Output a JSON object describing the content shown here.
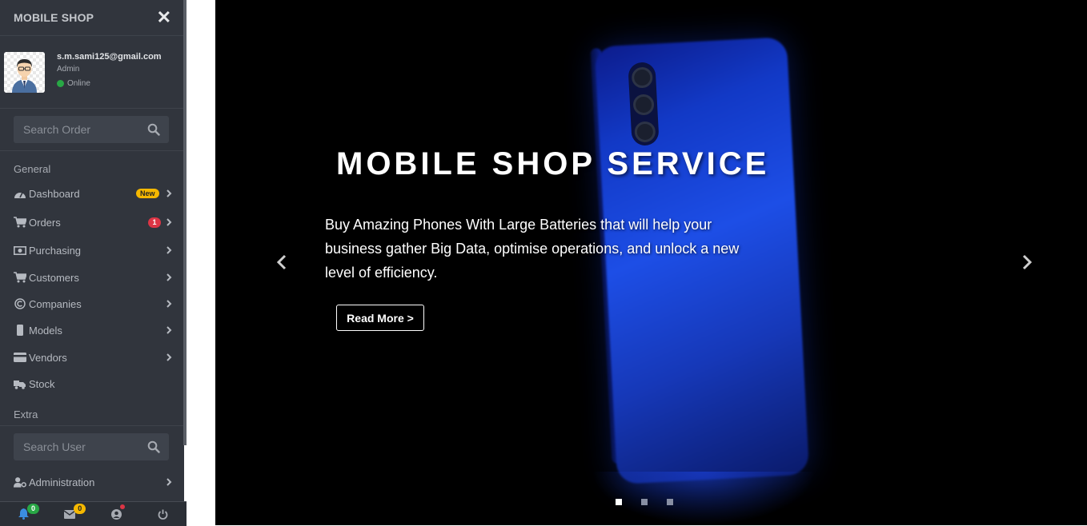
{
  "sidebar": {
    "brand": "MOBILE SHOP",
    "user": {
      "email": "s.m.sami125@gmail.com",
      "role": "Admin",
      "status": "Online"
    },
    "search_order_placeholder": "Search Order",
    "general_header": "General",
    "items": [
      {
        "label": "Dashboard",
        "icon": "dashboard-icon",
        "badge": "New"
      },
      {
        "label": "Orders",
        "icon": "cart-icon",
        "badge": "1"
      },
      {
        "label": "Purchasing",
        "icon": "money-icon"
      },
      {
        "label": "Customers",
        "icon": "cart-icon"
      },
      {
        "label": "Companies",
        "icon": "copyright-icon"
      },
      {
        "label": "Models",
        "icon": "mobile-icon"
      },
      {
        "label": "Vendors",
        "icon": "credit-card-icon"
      },
      {
        "label": "Stock",
        "icon": "truck-icon"
      }
    ],
    "extra_header": "Extra",
    "search_user_placeholder": "Search User",
    "admin_item": {
      "label": "Administration",
      "icon": "user-cog-icon"
    },
    "footer": {
      "notifications": "0",
      "messages": "0"
    }
  },
  "hero": {
    "title": "MOBILE SHOP SERVICE",
    "text": "Buy Amazing Phones With Large Batteries that will help your business gather Big Data, optimise operations, and unlock a new level of efficiency.",
    "button": "Read More >",
    "active_slide": 1,
    "slide_count": 3
  },
  "colors": {
    "sidebar_bg": "#31353d",
    "accent_new": "#f5b800",
    "accent_red": "#dc3545",
    "online": "#28a745"
  }
}
